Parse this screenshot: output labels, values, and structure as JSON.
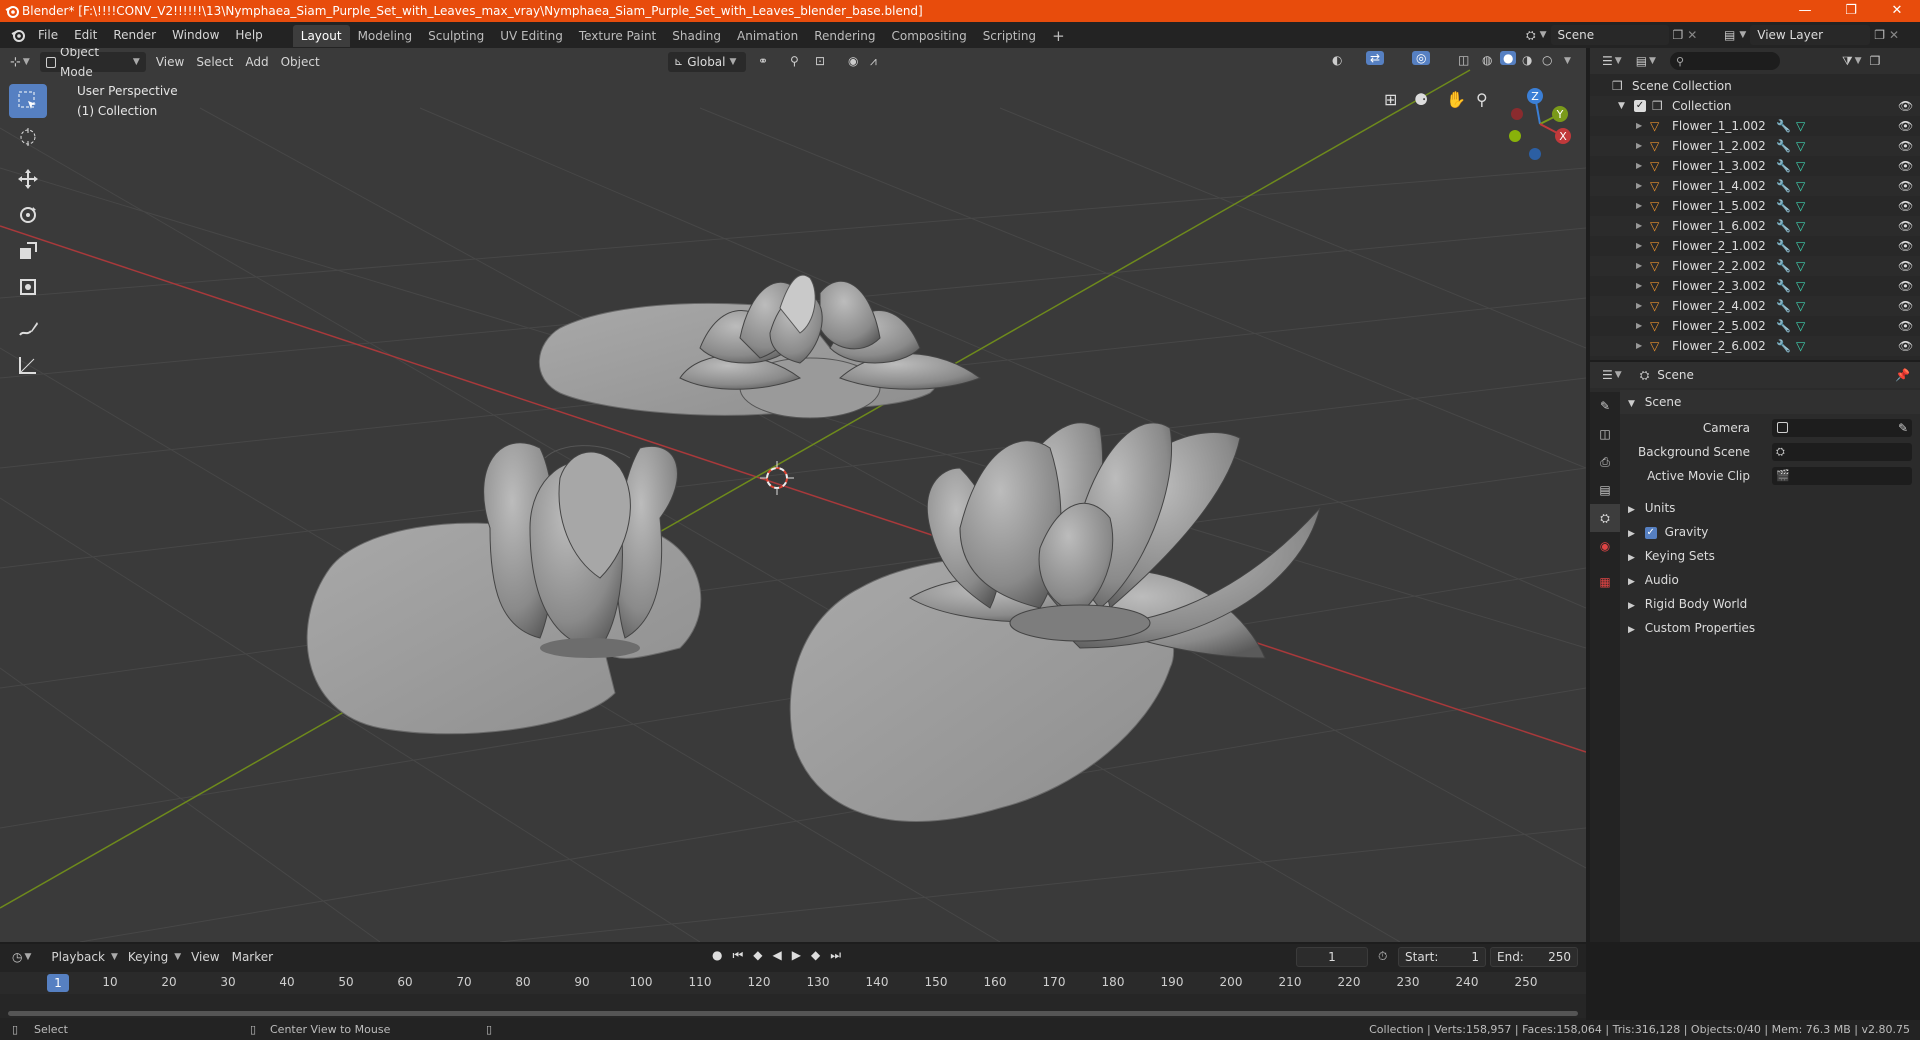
{
  "window": {
    "title": "Blender* [F:\\!!!!CONV_V2!!!!!!\\13\\Nymphaea_Siam_Purple_Set_with_Leaves_max_vray\\Nymphaea_Siam_Purple_Set_with_Leaves_blender_base.blend]",
    "minimize": "—",
    "maximize": "❐",
    "close": "✕"
  },
  "menu": [
    "File",
    "Edit",
    "Render",
    "Window",
    "Help"
  ],
  "workspaces": [
    {
      "label": "Layout",
      "active": true
    },
    {
      "label": "Modeling"
    },
    {
      "label": "Sculpting"
    },
    {
      "label": "UV Editing"
    },
    {
      "label": "Texture Paint"
    },
    {
      "label": "Shading"
    },
    {
      "label": "Animation"
    },
    {
      "label": "Rendering"
    },
    {
      "label": "Compositing"
    },
    {
      "label": "Scripting"
    }
  ],
  "add_workspace": "+",
  "scene_field": "Scene",
  "view_layer_field": "View Layer",
  "viewport": {
    "mode": "Object Mode",
    "menus": [
      "View",
      "Select",
      "Add",
      "Object"
    ],
    "transform_orientation": "Global",
    "perspective_label": "User Perspective",
    "collection_label": "(1) Collection",
    "gizmo": {
      "z": "Z",
      "y": "Y",
      "x": "X"
    }
  },
  "outliner": {
    "root": "Scene Collection",
    "collection": "Collection",
    "items": [
      "Flower_1_1.002",
      "Flower_1_2.002",
      "Flower_1_3.002",
      "Flower_1_4.002",
      "Flower_1_5.002",
      "Flower_1_6.002",
      "Flower_2_1.002",
      "Flower_2_2.002",
      "Flower_2_3.002",
      "Flower_2_4.002",
      "Flower_2_5.002",
      "Flower_2_6.002"
    ]
  },
  "properties": {
    "context": "Scene",
    "panel_title": "Scene",
    "camera_label": "Camera",
    "background_scene_label": "Background Scene",
    "active_movie_clip_label": "Active Movie Clip",
    "sections": [
      "Units",
      "Gravity",
      "Keying Sets",
      "Audio",
      "Rigid Body World",
      "Custom Properties"
    ]
  },
  "timeline": {
    "menus": [
      "Playback",
      "Keying",
      "View",
      "Marker"
    ],
    "current_frame": "1",
    "start_label": "Start:",
    "start": "1",
    "end_label": "End:",
    "end": "250",
    "ruler": [
      "10",
      "20",
      "30",
      "40",
      "50",
      "60",
      "70",
      "80",
      "90",
      "100",
      "110",
      "120",
      "130",
      "140",
      "150",
      "160",
      "170",
      "180",
      "190",
      "200",
      "210",
      "220",
      "230",
      "240",
      "250"
    ],
    "playhead": "1"
  },
  "status": {
    "select": "Select",
    "center_view": "Center View to Mouse",
    "stats": "Collection | Verts:158,957 | Faces:158,064 | Tris:316,128 | Objects:0/40 | Mem: 76.3 MB | v2.80.75"
  },
  "colors": {
    "titlebar": "#e84c0c",
    "accent_blue": "#5680c2",
    "x_axis": "#c0393b",
    "y_axis": "#7a9a1a",
    "z_axis": "#3b7fd6"
  }
}
